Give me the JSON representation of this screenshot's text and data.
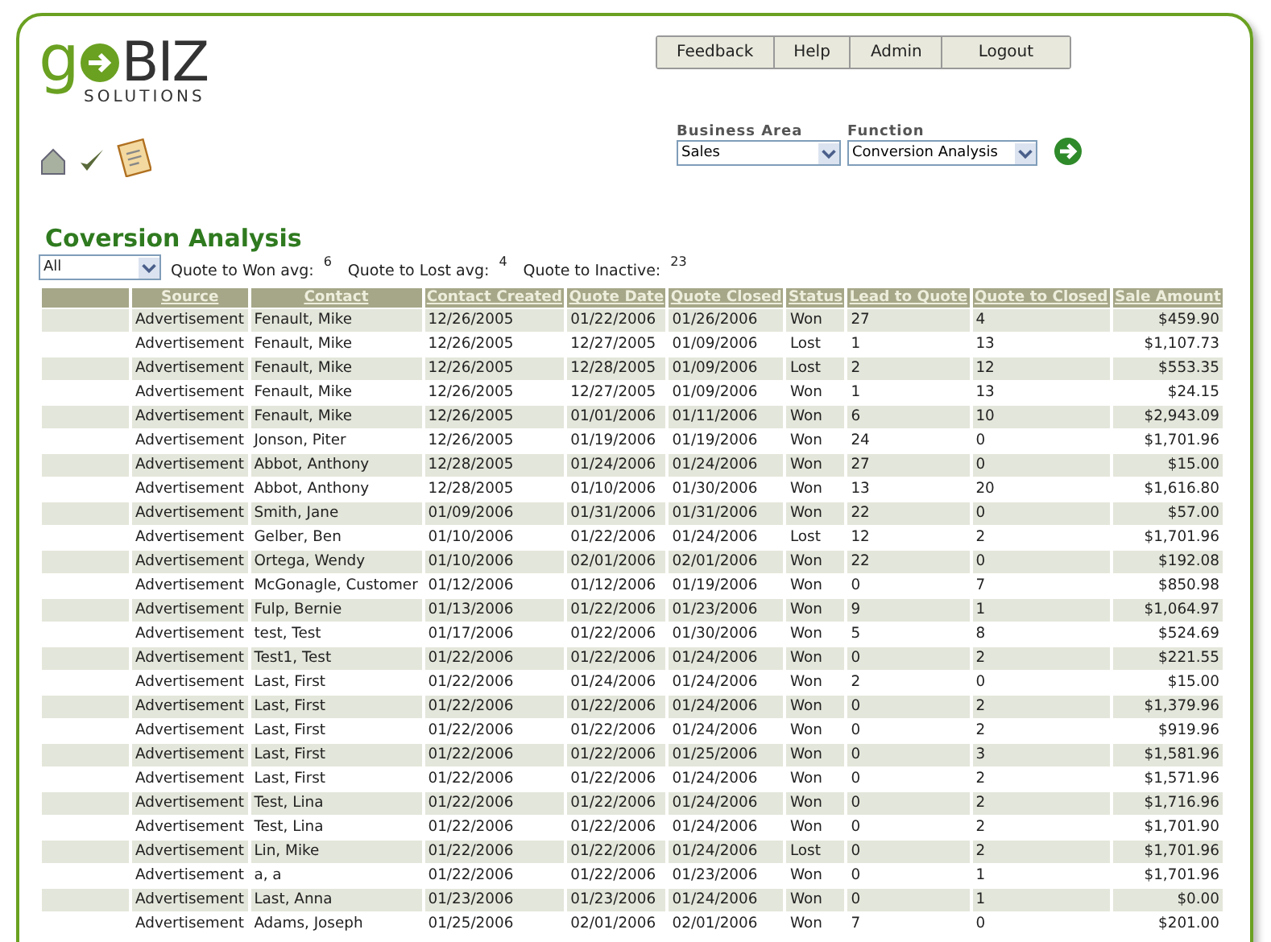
{
  "logo": {
    "prefix": "g",
    "main": "BIZ",
    "sub": "SOLUTIONS"
  },
  "nav_buttons": [
    "Feedback",
    "Help",
    "Admin",
    "Logout"
  ],
  "selectors": [
    {
      "label": "Business Area",
      "value": "Sales"
    },
    {
      "label": "Function",
      "value": "Conversion Analysis"
    }
  ],
  "heading": "Coversion Analysis",
  "filter": {
    "value": "All"
  },
  "stats": [
    {
      "label": "Quote to Won avg:",
      "value": "6"
    },
    {
      "label": "Quote to Lost avg:",
      "value": "4"
    },
    {
      "label": "Quote to Inactive:",
      "value": "23"
    }
  ],
  "table": {
    "columns": [
      "Source",
      "Contact",
      "Contact Created",
      "Quote Date",
      "Quote Closed",
      "Status",
      "Lead to Quote",
      "Quote to Closed",
      "Sale Amount"
    ],
    "rows": [
      [
        "Advertisement",
        "Fenault, Mike",
        "12/26/2005",
        "01/22/2006",
        "01/26/2006",
        "Won",
        "27",
        "4",
        "$459.90"
      ],
      [
        "Advertisement",
        "Fenault, Mike",
        "12/26/2005",
        "12/27/2005",
        "01/09/2006",
        "Lost",
        "1",
        "13",
        "$1,107.73"
      ],
      [
        "Advertisement",
        "Fenault, Mike",
        "12/26/2005",
        "12/28/2005",
        "01/09/2006",
        "Lost",
        "2",
        "12",
        "$553.35"
      ],
      [
        "Advertisement",
        "Fenault, Mike",
        "12/26/2005",
        "12/27/2005",
        "01/09/2006",
        "Won",
        "1",
        "13",
        "$24.15"
      ],
      [
        "Advertisement",
        "Fenault, Mike",
        "12/26/2005",
        "01/01/2006",
        "01/11/2006",
        "Won",
        "6",
        "10",
        "$2,943.09"
      ],
      [
        "Advertisement",
        "Jonson, Piter",
        "12/26/2005",
        "01/19/2006",
        "01/19/2006",
        "Won",
        "24",
        "0",
        "$1,701.96"
      ],
      [
        "Advertisement",
        "Abbot, Anthony",
        "12/28/2005",
        "01/24/2006",
        "01/24/2006",
        "Won",
        "27",
        "0",
        "$15.00"
      ],
      [
        "Advertisement",
        "Abbot, Anthony",
        "12/28/2005",
        "01/10/2006",
        "01/30/2006",
        "Won",
        "13",
        "20",
        "$1,616.80"
      ],
      [
        "Advertisement",
        "Smith, Jane",
        "01/09/2006",
        "01/31/2006",
        "01/31/2006",
        "Won",
        "22",
        "0",
        "$57.00"
      ],
      [
        "Advertisement",
        "Gelber, Ben",
        "01/10/2006",
        "01/22/2006",
        "01/24/2006",
        "Lost",
        "12",
        "2",
        "$1,701.96"
      ],
      [
        "Advertisement",
        "Ortega, Wendy",
        "01/10/2006",
        "02/01/2006",
        "02/01/2006",
        "Won",
        "22",
        "0",
        "$192.08"
      ],
      [
        "Advertisement",
        "McGonagle, Customer",
        "01/12/2006",
        "01/12/2006",
        "01/19/2006",
        "Won",
        "0",
        "7",
        "$850.98"
      ],
      [
        "Advertisement",
        "Fulp, Bernie",
        "01/13/2006",
        "01/22/2006",
        "01/23/2006",
        "Won",
        "9",
        "1",
        "$1,064.97"
      ],
      [
        "Advertisement",
        "test, Test",
        "01/17/2006",
        "01/22/2006",
        "01/30/2006",
        "Won",
        "5",
        "8",
        "$524.69"
      ],
      [
        "Advertisement",
        "Test1, Test",
        "01/22/2006",
        "01/22/2006",
        "01/24/2006",
        "Won",
        "0",
        "2",
        "$221.55"
      ],
      [
        "Advertisement",
        "Last, First",
        "01/22/2006",
        "01/24/2006",
        "01/24/2006",
        "Won",
        "2",
        "0",
        "$15.00"
      ],
      [
        "Advertisement",
        "Last, First",
        "01/22/2006",
        "01/22/2006",
        "01/24/2006",
        "Won",
        "0",
        "2",
        "$1,379.96"
      ],
      [
        "Advertisement",
        "Last, First",
        "01/22/2006",
        "01/22/2006",
        "01/24/2006",
        "Won",
        "0",
        "2",
        "$919.96"
      ],
      [
        "Advertisement",
        "Last, First",
        "01/22/2006",
        "01/22/2006",
        "01/25/2006",
        "Won",
        "0",
        "3",
        "$1,581.96"
      ],
      [
        "Advertisement",
        "Last, First",
        "01/22/2006",
        "01/22/2006",
        "01/24/2006",
        "Won",
        "0",
        "2",
        "$1,571.96"
      ],
      [
        "Advertisement",
        "Test, Lina",
        "01/22/2006",
        "01/22/2006",
        "01/24/2006",
        "Won",
        "0",
        "2",
        "$1,716.96"
      ],
      [
        "Advertisement",
        "Test, Lina",
        "01/22/2006",
        "01/22/2006",
        "01/24/2006",
        "Won",
        "0",
        "2",
        "$1,701.90"
      ],
      [
        "Advertisement",
        "Lin, Mike",
        "01/22/2006",
        "01/22/2006",
        "01/24/2006",
        "Lost",
        "0",
        "2",
        "$1,701.96"
      ],
      [
        "Advertisement",
        "a, a",
        "01/22/2006",
        "01/22/2006",
        "01/23/2006",
        "Won",
        "0",
        "1",
        "$1,701.96"
      ],
      [
        "Advertisement",
        "Last, Anna",
        "01/23/2006",
        "01/23/2006",
        "01/24/2006",
        "Won",
        "0",
        "1",
        "$0.00"
      ],
      [
        "Advertisement",
        "Adams, Joseph",
        "01/25/2006",
        "02/01/2006",
        "02/01/2006",
        "Won",
        "7",
        "0",
        "$201.00"
      ]
    ]
  }
}
